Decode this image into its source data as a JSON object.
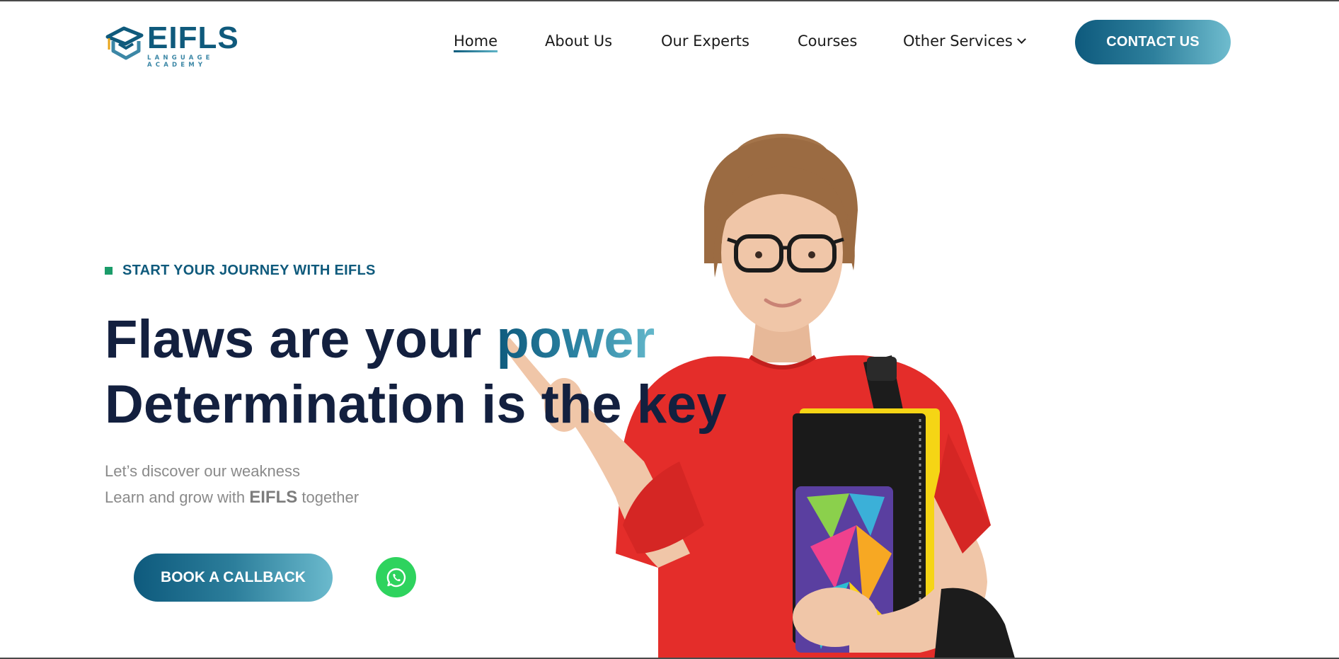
{
  "brand": {
    "name": "EIFLS",
    "tagline": "LANGUAGE ACADEMY",
    "colors": {
      "primary": "#0f5a7c",
      "accent_light": "#64b8cb",
      "heading": "#13203f",
      "kicker_marker": "#1b9c6a",
      "whatsapp": "#2ed35e"
    }
  },
  "nav": {
    "items": [
      {
        "label": "Home",
        "active": true
      },
      {
        "label": "About Us"
      },
      {
        "label": "Our Experts"
      },
      {
        "label": "Courses"
      },
      {
        "label": "Other Services",
        "icon": "chevron-down-icon"
      }
    ],
    "cta_label": "CONTACT US"
  },
  "hero": {
    "kicker": "START YOUR JOURNEY WITH EIFLS",
    "headline_line1_prefix": "Flaws are your ",
    "headline_line1_accent": "power",
    "headline_line2": "Determination is the key",
    "sub_line1": "Let’s discover our weakness",
    "sub_line2_prefix": "Learn and grow with ",
    "sub_line2_brand": "EIFLS",
    "sub_line2_suffix": " together",
    "cta_label": "BOOK A CALLBACK",
    "whatsapp_icon": "whatsapp-icon",
    "image": "student-with-notebooks-photo"
  }
}
